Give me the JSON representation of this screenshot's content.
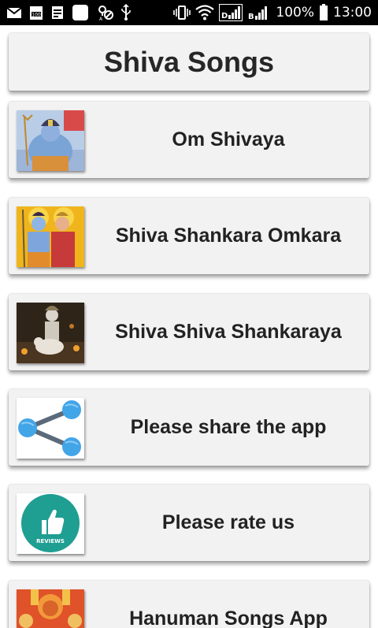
{
  "status_bar": {
    "battery_percent": "100%",
    "time": "13:00",
    "left_icons": [
      "mail-icon",
      "calendar-100-icon",
      "notes-icon",
      "white-app-icon",
      "location-off-icon",
      "usb-icon"
    ],
    "right_icons": [
      "vibrate-icon",
      "wifi-icon",
      "signal-sim1-icon",
      "signal-sim2-icon",
      "battery-icon"
    ]
  },
  "header": {
    "title": "Shiva Songs"
  },
  "items": [
    {
      "label": "Om Shivaya",
      "icon": "shiva-portrait-thumbnail"
    },
    {
      "label": "Shiva Shankara Omkara",
      "icon": "shiva-parvati-thumbnail"
    },
    {
      "label": "Shiva Shiva Shankaraya",
      "icon": "shiva-nandi-thumbnail"
    },
    {
      "label": "Please share the app",
      "icon": "share-icon"
    },
    {
      "label": "Please rate us",
      "icon": "reviews-thumbs-up-icon",
      "badge_text": "REVIEWS"
    },
    {
      "label": "Hanuman Songs App",
      "icon": "hanuman-thumbnail"
    }
  ],
  "colors": {
    "status_bar_bg": "#000000",
    "card_bg": "#f2f2f2",
    "text": "#222222",
    "share_accent": "#42a5e8",
    "reviews_teal": "#1f9e92"
  }
}
